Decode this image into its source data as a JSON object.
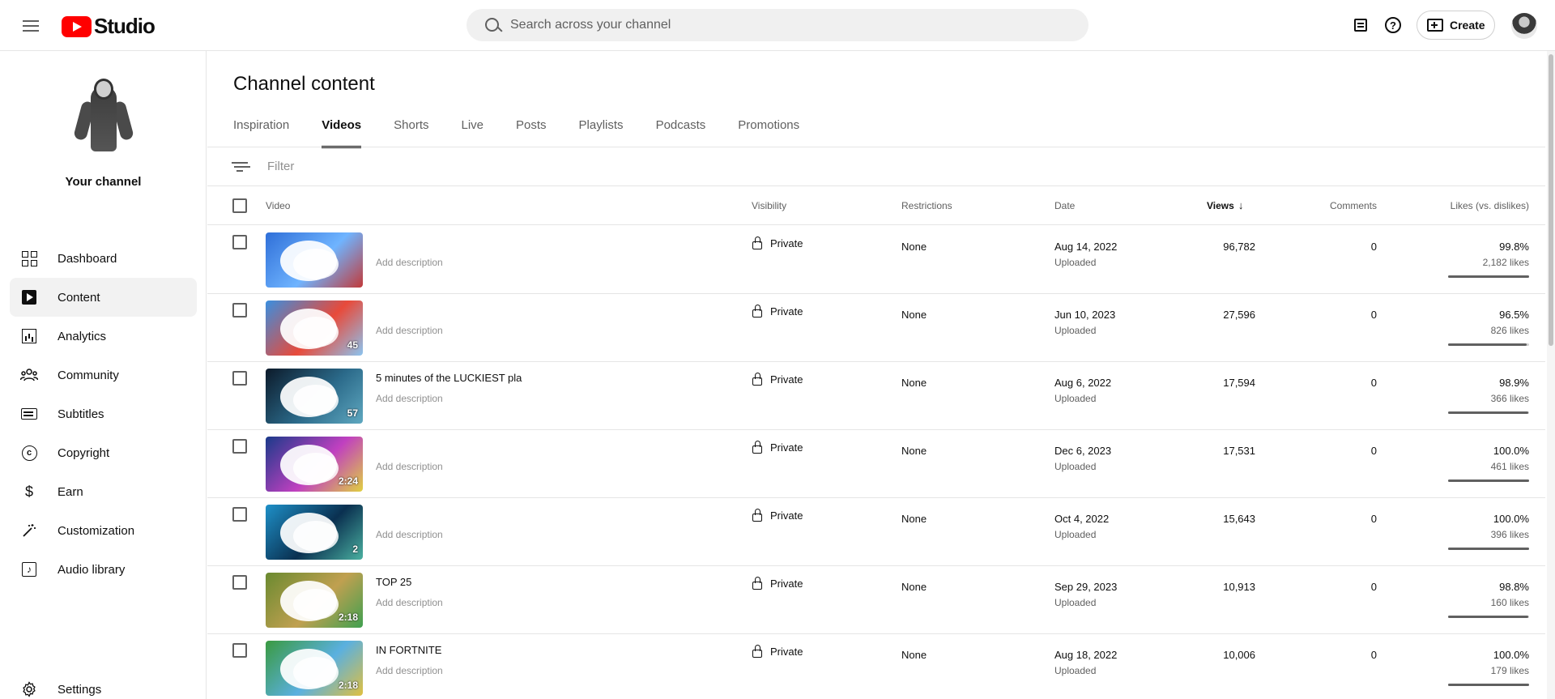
{
  "header": {
    "logo_text": "Studio",
    "search_placeholder": "Search across your channel",
    "create_label": "Create"
  },
  "sidebar": {
    "channel_label": "Your channel",
    "items": [
      {
        "label": "Dashboard",
        "icon": "dashboard-icon"
      },
      {
        "label": "Content",
        "icon": "content-icon",
        "active": true
      },
      {
        "label": "Analytics",
        "icon": "analytics-icon"
      },
      {
        "label": "Community",
        "icon": "community-icon"
      },
      {
        "label": "Subtitles",
        "icon": "subtitles-icon"
      },
      {
        "label": "Copyright",
        "icon": "copyright-icon"
      },
      {
        "label": "Earn",
        "icon": "dollar-icon"
      },
      {
        "label": "Customization",
        "icon": "magic-wand-icon"
      },
      {
        "label": "Audio library",
        "icon": "audio-library-icon"
      }
    ],
    "settings_label": "Settings"
  },
  "main": {
    "title": "Channel content",
    "tabs": [
      {
        "label": "Inspiration"
      },
      {
        "label": "Videos",
        "active": true
      },
      {
        "label": "Shorts"
      },
      {
        "label": "Live"
      },
      {
        "label": "Posts"
      },
      {
        "label": "Playlists"
      },
      {
        "label": "Podcasts"
      },
      {
        "label": "Promotions"
      }
    ],
    "filter_placeholder": "Filter",
    "columns": {
      "video": "Video",
      "visibility": "Visibility",
      "restrictions": "Restrictions",
      "date": "Date",
      "views": "Views",
      "comments": "Comments",
      "likes": "Likes (vs. dislikes)"
    },
    "rows": [
      {
        "title": "",
        "description": "Add description",
        "duration": "",
        "visibility": "Private",
        "restrictions": "None",
        "date": "Aug 14, 2022",
        "date_status": "Uploaded",
        "views": "96,782",
        "comments": "0",
        "likes_pct": "99.8%",
        "likes_count": "2,182 likes",
        "like_ratio": 0.998,
        "thumb_colors": [
          "#2f6fd8",
          "#6fb4ff",
          "#c23a3a"
        ]
      },
      {
        "title": "",
        "description": "Add description",
        "duration": "45",
        "visibility": "Private",
        "restrictions": "None",
        "date": "Jun 10, 2023",
        "date_status": "Uploaded",
        "views": "27,596",
        "comments": "0",
        "likes_pct": "96.5%",
        "likes_count": "826 likes",
        "like_ratio": 0.965,
        "thumb_colors": [
          "#3a8fe0",
          "#e84a3a",
          "#8bc4f0"
        ]
      },
      {
        "title": "5 minutes of the LUCKIEST pla",
        "description": "Add description",
        "duration": "57",
        "visibility": "Private",
        "restrictions": "None",
        "date": "Aug 6, 2022",
        "date_status": "Uploaded",
        "views": "17,594",
        "comments": "0",
        "likes_pct": "98.9%",
        "likes_count": "366 likes",
        "like_ratio": 0.989,
        "thumb_colors": [
          "#0c1a2a",
          "#2b6a8a",
          "#5fa8c0"
        ]
      },
      {
        "title": "",
        "description": "Add description",
        "duration": "2:24",
        "visibility": "Private",
        "restrictions": "None",
        "date": "Dec 6, 2023",
        "date_status": "Uploaded",
        "views": "17,531",
        "comments": "0",
        "likes_pct": "100.0%",
        "likes_count": "461 likes",
        "like_ratio": 1.0,
        "thumb_colors": [
          "#1a3a8a",
          "#c040c0",
          "#e0d040"
        ]
      },
      {
        "title": "",
        "description": "Add description",
        "duration": "2",
        "visibility": "Private",
        "restrictions": "None",
        "date": "Oct 4, 2022",
        "date_status": "Uploaded",
        "views": "15,643",
        "comments": "0",
        "likes_pct": "100.0%",
        "likes_count": "396 likes",
        "like_ratio": 1.0,
        "thumb_colors": [
          "#1e90c8",
          "#0a3050",
          "#4ab0a0"
        ]
      },
      {
        "title": "TOP 25",
        "description": "Add description",
        "duration": "2:18",
        "visibility": "Private",
        "restrictions": "None",
        "date": "Sep 29, 2023",
        "date_status": "Uploaded",
        "views": "10,913",
        "comments": "0",
        "likes_pct": "98.8%",
        "likes_count": "160 likes",
        "like_ratio": 0.988,
        "thumb_colors": [
          "#6a8a30",
          "#c0a050",
          "#40a050"
        ]
      },
      {
        "title": "IN FORTNITE",
        "description": "Add description",
        "duration": "2:18",
        "visibility": "Private",
        "restrictions": "None",
        "date": "Aug 18, 2022",
        "date_status": "Uploaded",
        "views": "10,006",
        "comments": "0",
        "likes_pct": "100.0%",
        "likes_count": "179 likes",
        "like_ratio": 1.0,
        "thumb_colors": [
          "#3a9a40",
          "#5ab0e0",
          "#e0c040"
        ]
      }
    ]
  }
}
